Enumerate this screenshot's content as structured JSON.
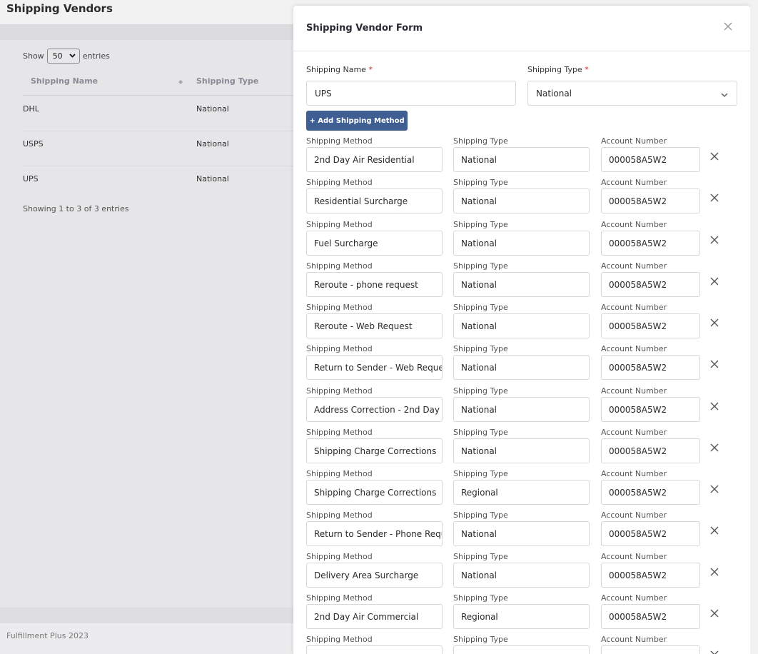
{
  "page": {
    "title": "Shipping Vendors",
    "show_label": "Show",
    "entries_value": "50",
    "entries_label": "entries",
    "columns": [
      "Shipping Name",
      "Shipping Type"
    ],
    "rows": [
      {
        "name": "DHL",
        "type": "National"
      },
      {
        "name": "USPS",
        "type": "National"
      },
      {
        "name": "UPS",
        "type": "National"
      }
    ],
    "showing_text": "Showing 1 to 3 of 3 entries",
    "footer": "Fulfillment Plus 2023"
  },
  "modal": {
    "title": "Shipping Vendor Form",
    "shipping_name_label": "Shipping Name",
    "shipping_name_value": "UPS",
    "shipping_type_label": "Shipping Type",
    "shipping_type_value": "National",
    "required_mark": "*",
    "add_button": "+ Add Shipping Method",
    "method_label": "Shipping Method",
    "type_label": "Shipping Type",
    "account_label": "Account Number",
    "methods": [
      {
        "method": "2nd Day Air Residential",
        "type": "National",
        "account": "000058A5W2"
      },
      {
        "method": "Residential Surcharge",
        "type": "National",
        "account": "000058A5W2"
      },
      {
        "method": "Fuel Surcharge",
        "type": "National",
        "account": "000058A5W2"
      },
      {
        "method": "Reroute - phone request",
        "type": "National",
        "account": "000058A5W2"
      },
      {
        "method": "Reroute - Web Request",
        "type": "National",
        "account": "000058A5W2"
      },
      {
        "method": "Return to Sender - Web Request",
        "type": "National",
        "account": "000058A5W2"
      },
      {
        "method": "Address Correction - 2nd Day",
        "type": "National",
        "account": "000058A5W2"
      },
      {
        "method": "Shipping Charge Corrections",
        "type": "National",
        "account": "000058A5W2"
      },
      {
        "method": "Shipping Charge Corrections",
        "type": "Regional",
        "account": "000058A5W2"
      },
      {
        "method": "Return to Sender - Phone Request",
        "type": "National",
        "account": "000058A5W2"
      },
      {
        "method": "Delivery Area Surcharge",
        "type": "National",
        "account": "000058A5W2"
      },
      {
        "method": "2nd Day Air Commercial",
        "type": "Regional",
        "account": "000058A5W2"
      },
      {
        "method": "",
        "type": "",
        "account": ""
      }
    ]
  },
  "colors": {
    "accent_button": "#3f5e92",
    "required": "#dd2222"
  }
}
